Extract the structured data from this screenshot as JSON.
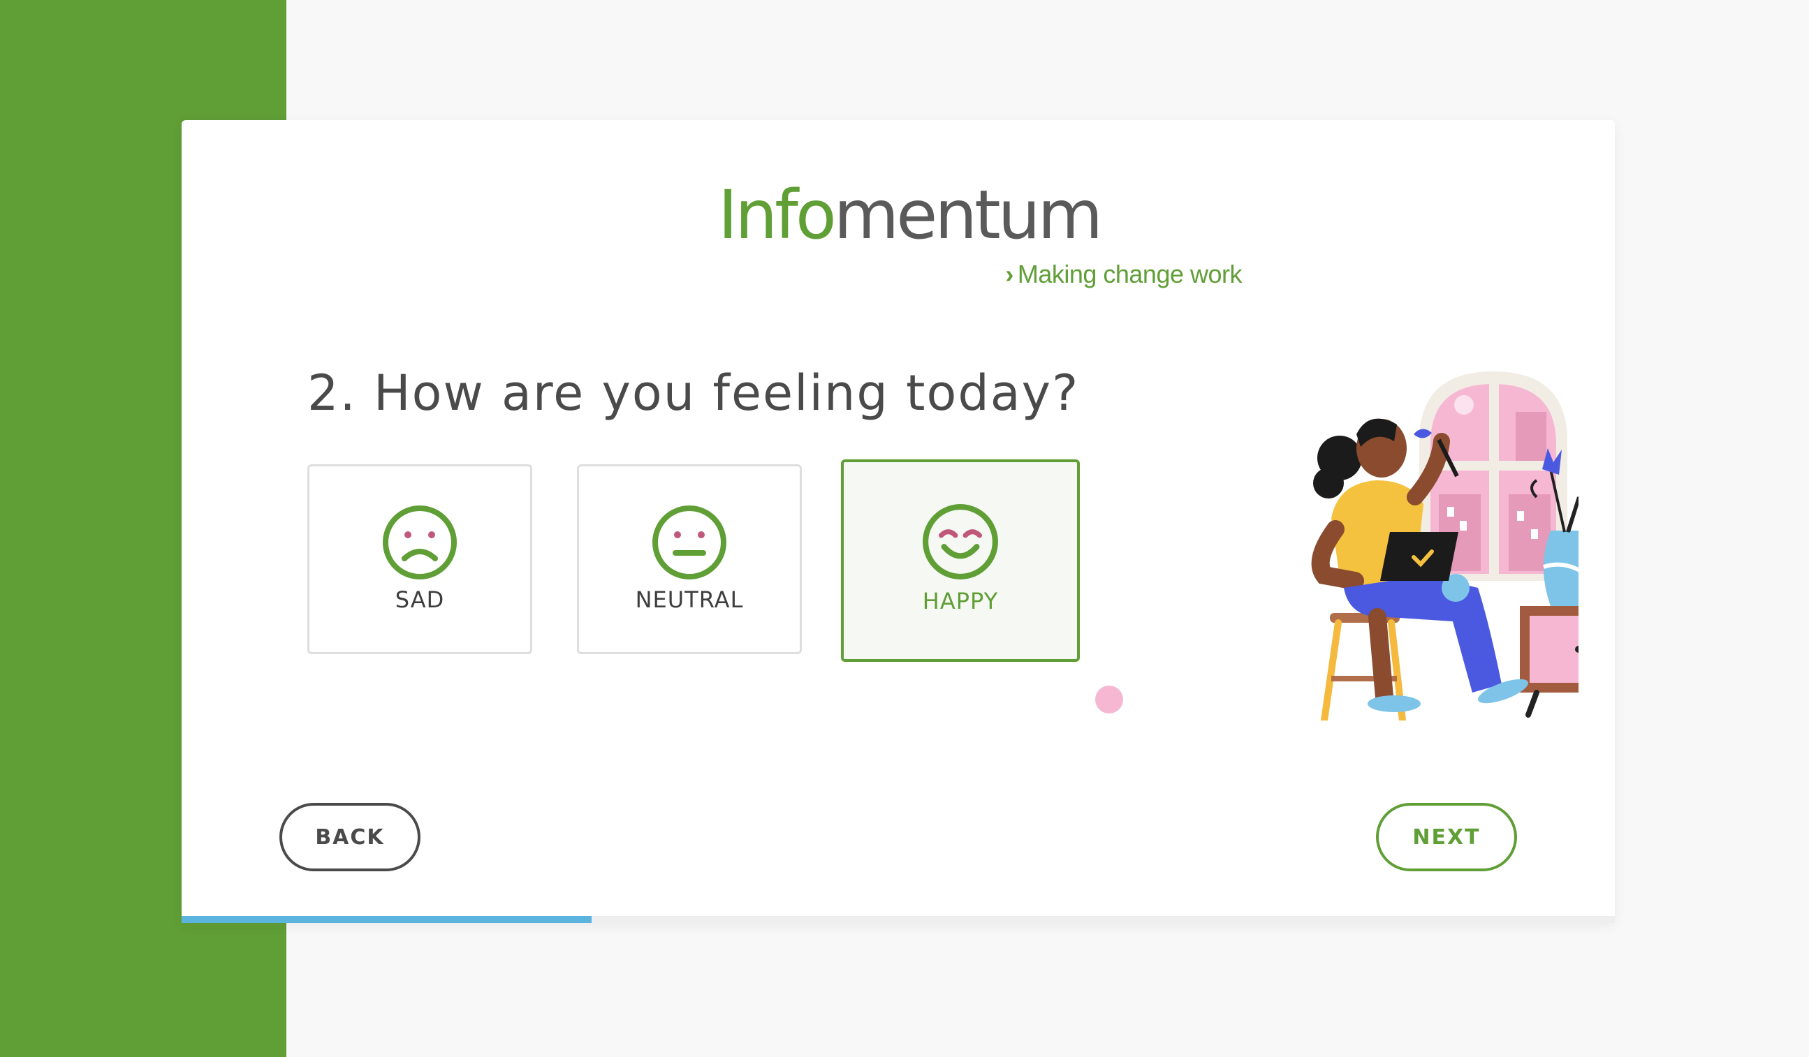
{
  "logo": {
    "word_part1": "Info",
    "word_part2": "mentum",
    "tagline_chevron": "›",
    "tagline": "Making change work"
  },
  "question": "2. How are you feeling today?",
  "options": [
    {
      "label": "SAD",
      "icon": "sad-face-icon",
      "selected": false
    },
    {
      "label": "NEUTRAL",
      "icon": "neutral-face-icon",
      "selected": false
    },
    {
      "label": "HAPPY",
      "icon": "happy-face-icon",
      "selected": true
    }
  ],
  "buttons": {
    "back": "BACK",
    "next": "NEXT"
  },
  "progress": {
    "fraction": 0.286
  },
  "colors": {
    "brand_green": "#609e36",
    "progress_blue": "#5ab4de",
    "text_dark": "#4a4a4a",
    "face_accent": "#c0587a"
  }
}
